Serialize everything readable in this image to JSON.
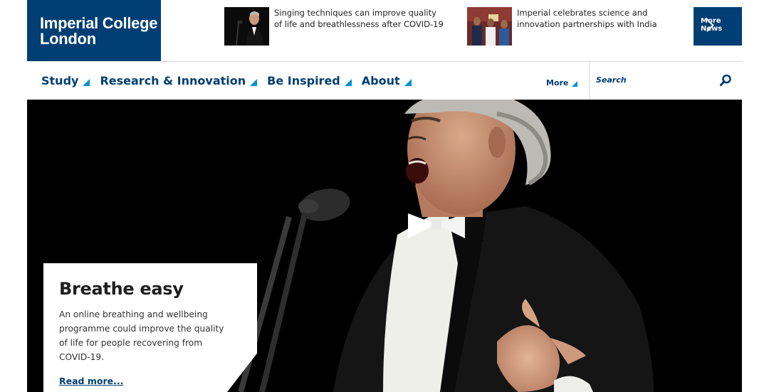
{
  "logo": {
    "line1": "Imperial College",
    "line2": "London"
  },
  "news": [
    {
      "text": "Singing techniques can improve quality of life and breathlessness after COVID-19"
    },
    {
      "text": "Imperial celebrates science and innovation partnerships with India"
    }
  ],
  "more_news_label": "More News",
  "nav": {
    "items": [
      {
        "label": "Study"
      },
      {
        "label": "Research & Innovation"
      },
      {
        "label": "Be Inspired"
      },
      {
        "label": "About"
      }
    ],
    "more_label": "More"
  },
  "search": {
    "placeholder": "Search"
  },
  "hero": {
    "title": "Breathe easy",
    "body": "An online breathing and wellbeing programme could improve the quality of life for people recovering from COVID-19.",
    "link": "Read more..."
  },
  "colors": {
    "brand_navy": "#003e74",
    "accent_blue": "#0091d4",
    "hero_bg": "#000000"
  }
}
